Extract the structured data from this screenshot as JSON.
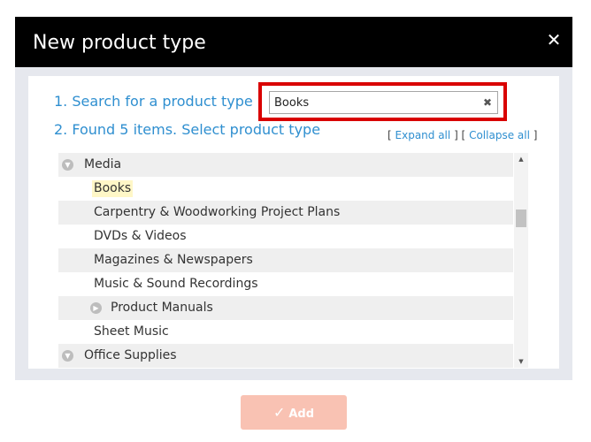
{
  "modal": {
    "title": "New product type",
    "close_icon": "close-icon"
  },
  "steps": {
    "search_prompt": "1. Search for a product type",
    "found_text": "2. Found 5 items. Select product type"
  },
  "search": {
    "value": "Books",
    "placeholder": "",
    "clear_icon": "clear-icon"
  },
  "tree_controls": {
    "bracket_open": "[",
    "expand_all": "Expand all",
    "separator": "] [",
    "collapse_all": "Collapse all",
    "bracket_close": "]"
  },
  "tree": {
    "items": [
      {
        "label": "Media",
        "level": 0,
        "expanded": true,
        "highlighted": false
      },
      {
        "label": "Books",
        "level": 1,
        "expanded": false,
        "highlighted": true
      },
      {
        "label": "Carpentry & Woodworking Project Plans",
        "level": 1,
        "highlighted": false
      },
      {
        "label": "DVDs & Videos",
        "level": 1,
        "highlighted": false
      },
      {
        "label": "Magazines & Newspapers",
        "level": 1,
        "highlighted": false
      },
      {
        "label": "Music & Sound Recordings",
        "level": 1,
        "highlighted": false
      },
      {
        "label": "Product Manuals",
        "level": 1,
        "expanded": false,
        "highlighted": false
      },
      {
        "label": "Sheet Music",
        "level": 1,
        "highlighted": false
      },
      {
        "label": "Office Supplies",
        "level": 0,
        "expanded": true,
        "highlighted": false
      }
    ]
  },
  "footer": {
    "add_label": "Add",
    "add_icon": "check-icon"
  },
  "colors": {
    "accent": "#2f8fd0",
    "header": "#000000",
    "highlight_border": "#d90000",
    "add_button": "#f9c2b3",
    "match_highlight": "#fff7c7"
  }
}
